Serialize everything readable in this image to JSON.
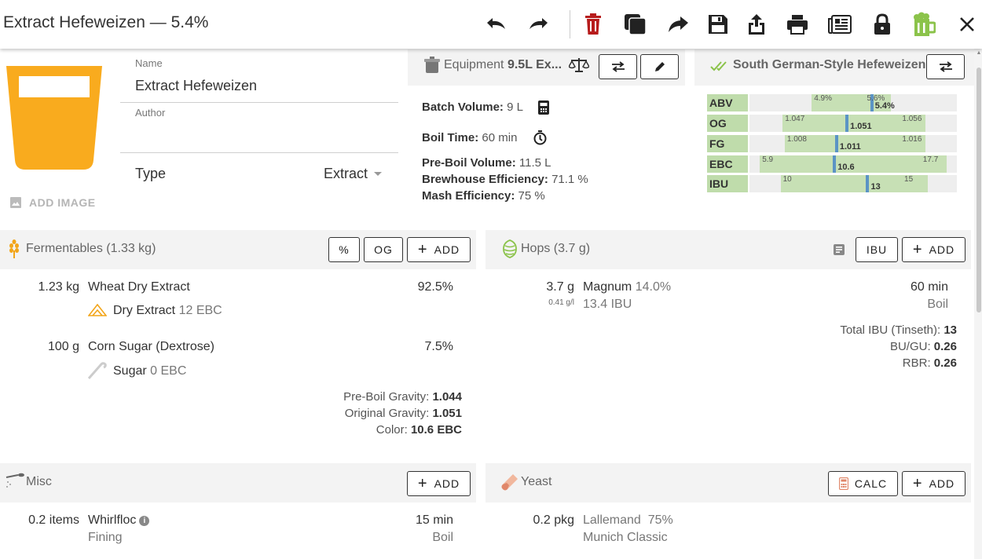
{
  "title": "Extract Hefeweizen — 5.4%",
  "toolbar_icons": [
    "undo-icon",
    "redo-icon",
    "delete-icon",
    "copy-icon",
    "share-icon",
    "save-icon",
    "export-icon",
    "print-icon",
    "newspaper-icon",
    "lock-icon",
    "beer-mug-icon",
    "close-icon"
  ],
  "recipe": {
    "name_label": "Name",
    "name_value": "Extract Hefeweizen",
    "author_label": "Author",
    "author_value": "",
    "type_label": "Type",
    "type_value": "Extract",
    "add_image": "ADD IMAGE",
    "glass_color": "#f9ab1e"
  },
  "equipment": {
    "label": "Equipment",
    "name": "9.5L Ex...",
    "batch_volume_label": "Batch Volume:",
    "batch_volume_value": "9 L",
    "boil_time_label": "Boil Time:",
    "boil_time_value": "60 min",
    "preboil_label": "Pre-Boil Volume:",
    "preboil_value": "11.5 L",
    "brewhouse_label": "Brewhouse Efficiency:",
    "brewhouse_value": "71.1 %",
    "mash_label": "Mash Efficiency:",
    "mash_value": "75 %"
  },
  "style": {
    "name": "South German-Style Hefeweizen",
    "rows": [
      {
        "label": "ABV",
        "min": "4.9%",
        "max": "5.6%",
        "value": "5.4%",
        "range": [
          0.3,
          0.68
        ],
        "mark": 0.59
      },
      {
        "label": "OG",
        "min": "1.047",
        "max": "1.056",
        "value": "1.051",
        "range": [
          0.16,
          0.85
        ],
        "mark": 0.47
      },
      {
        "label": "FG",
        "min": "1.008",
        "max": "1.016",
        "value": "1.011",
        "range": [
          0.17,
          0.85
        ],
        "mark": 0.42
      },
      {
        "label": "EBC",
        "min": "5.9",
        "max": "17.7",
        "value": "10.6",
        "range": [
          0.05,
          0.95
        ],
        "mark": 0.41
      },
      {
        "label": "IBU",
        "min": "10",
        "max": "15",
        "value": "13",
        "range": [
          0.15,
          0.86
        ],
        "mark": 0.57
      }
    ]
  },
  "fermentables": {
    "title": "Fermentables (1.33 kg)",
    "btn_percent": "%",
    "btn_og": "OG",
    "btn_add": "ADD",
    "items": [
      {
        "amount": "1.23 kg",
        "name": "Wheat Dry Extract",
        "percent": "92.5%",
        "sub_type": "Dry Extract",
        "sub_color": "12 EBC"
      },
      {
        "amount": "100 g",
        "name": "Corn Sugar (Dextrose)",
        "percent": "7.5%",
        "sub_type": "Sugar",
        "sub_color": "0 EBC"
      }
    ],
    "preboil_gravity_label": "Pre-Boil Gravity:",
    "preboil_gravity_value": "1.044",
    "og_label": "Original Gravity:",
    "og_value": "1.051",
    "color_label": "Color:",
    "color_value": "10.6 EBC"
  },
  "hops": {
    "title": "Hops (3.7 g)",
    "btn_ibu": "IBU",
    "btn_add": "ADD",
    "items": [
      {
        "amount": "3.7 g",
        "amount_per": "0.41 g/l",
        "name": "Magnum",
        "alpha": "14.0%",
        "ibu": "13.4 IBU",
        "time": "60 min",
        "use": "Boil"
      }
    ],
    "total_ibu_label": "Total IBU (Tinseth):",
    "total_ibu_value": "13",
    "bugu_label": "BU/GU:",
    "bugu_value": "0.26",
    "rbr_label": "RBR:",
    "rbr_value": "0.26"
  },
  "misc": {
    "title": "Misc",
    "btn_add": "ADD",
    "items": [
      {
        "amount": "0.2 items",
        "name": "Whirlfloc",
        "type": "Fining",
        "time": "15 min",
        "use": "Boil"
      }
    ]
  },
  "yeast": {
    "title": "Yeast",
    "btn_calc": "CALC",
    "btn_add": "ADD",
    "items": [
      {
        "amount": "0.2 pkg",
        "lab": "Lallemand",
        "attenuation": "75%",
        "name": "Munich Classic"
      }
    ]
  }
}
